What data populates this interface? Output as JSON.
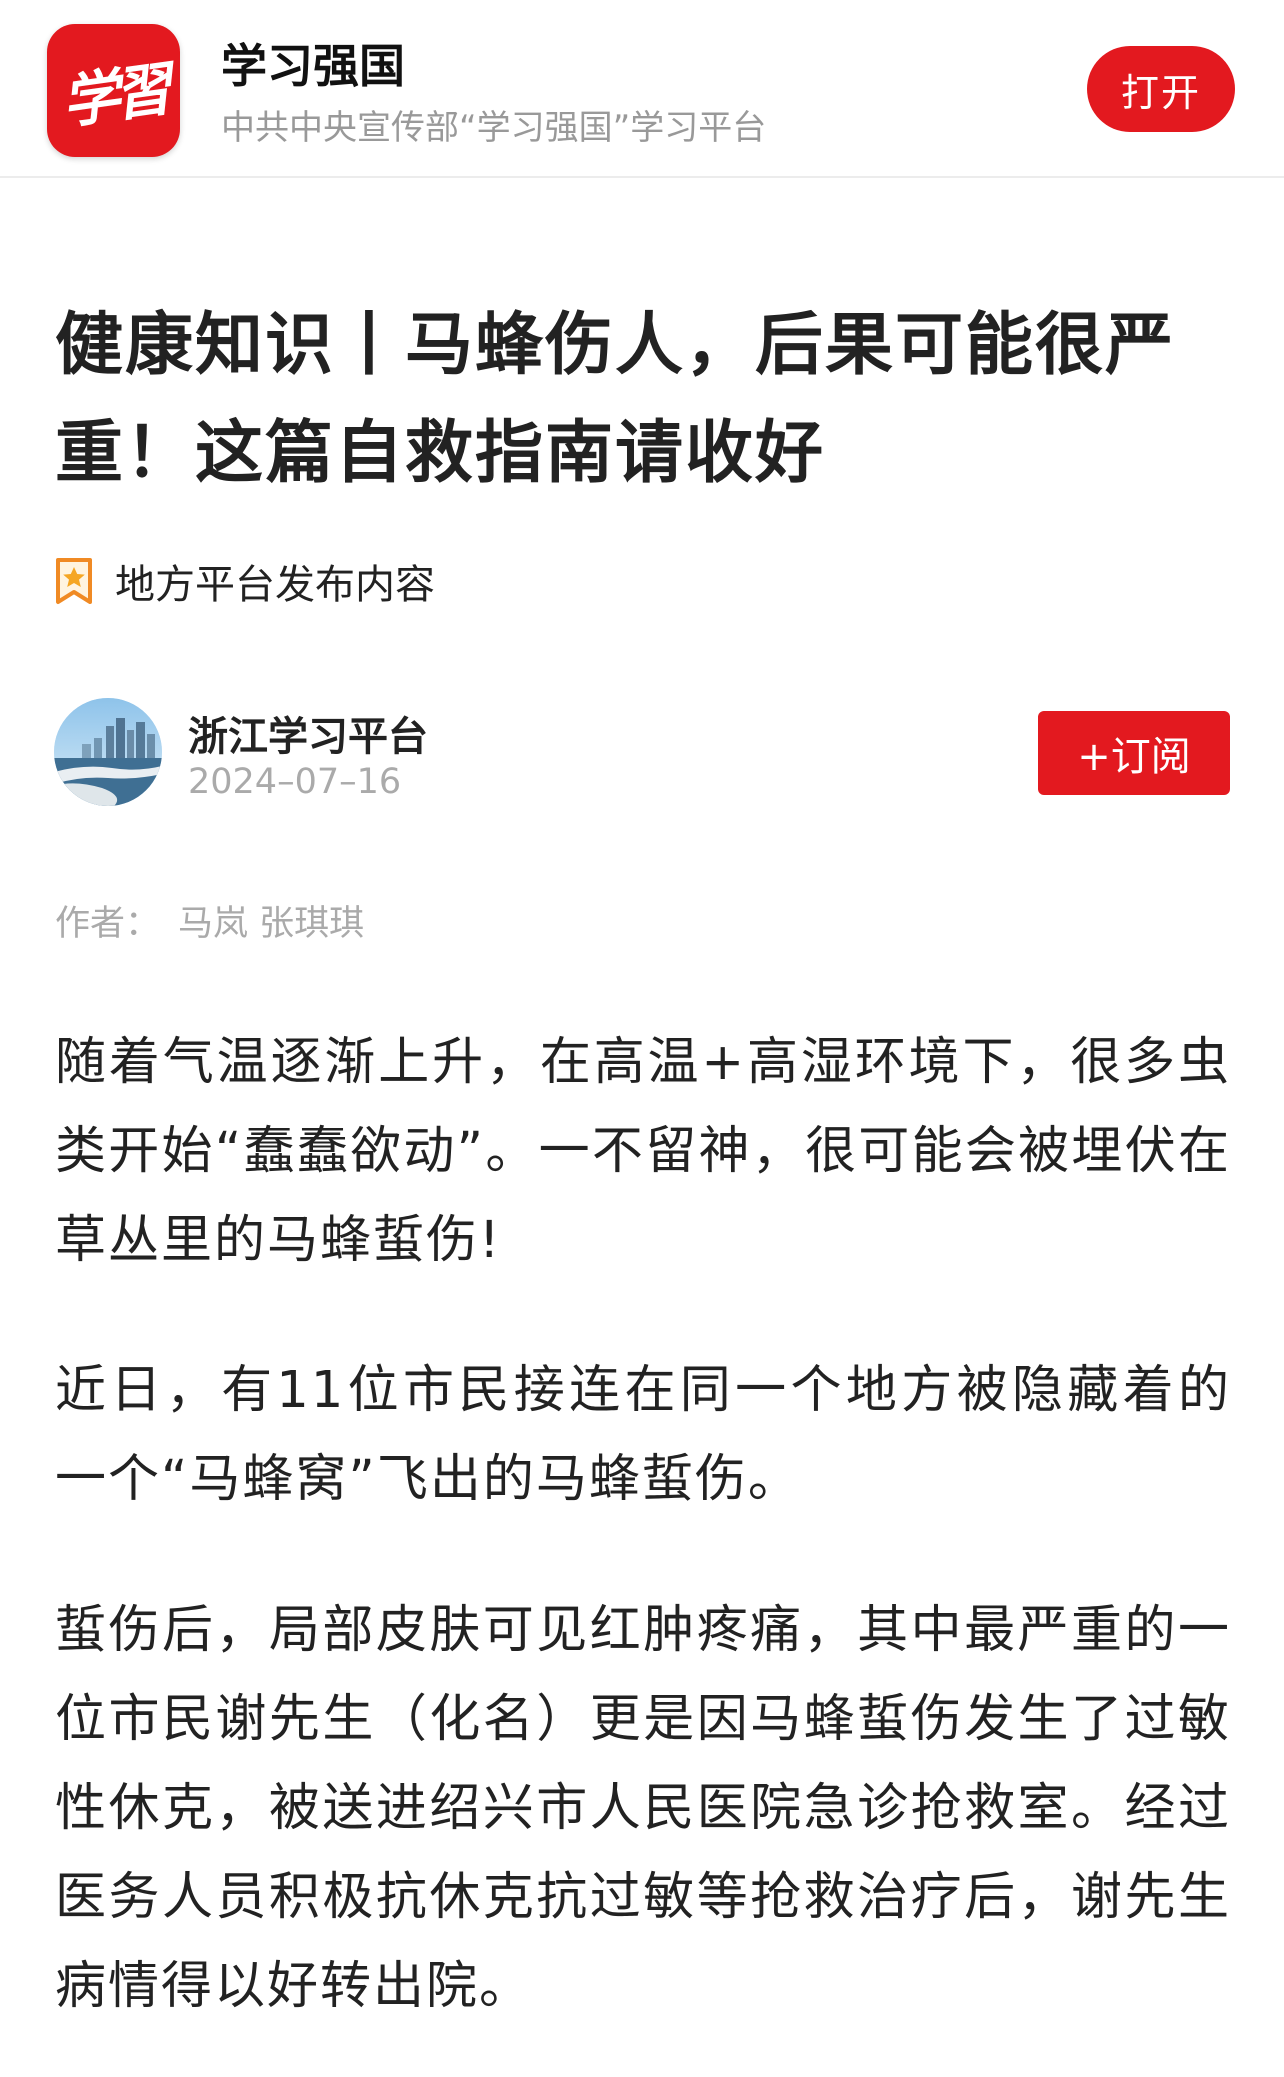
{
  "app_banner": {
    "icon_text": "学習",
    "name": "学习强国",
    "description": "中共中央宣传部“学习强国”学习平台",
    "open_label": "打开"
  },
  "article": {
    "title": "健康知识丨马蜂伤人，后果可能很严重！这篇自救指南请收好",
    "source_tag": "地方平台发布内容",
    "publisher": {
      "name": "浙江学习平台",
      "date": "2024–07–16",
      "subscribe_label": "+订阅"
    },
    "author_label": "作者：",
    "author_names": "马岚 张琪琪",
    "paragraphs": [
      "随着气温逐渐上升，在高温+高湿环境下，很多虫类开始“蠢蠢欲动”。一不留神，很可能会被埋伏在草丛里的马蜂蜇伤!",
      "近日，有11位市民接连在同一个地方被隐藏着的一个“马蜂窝”飞出的马蜂蜇伤。",
      "蜇伤后，局部皮肤可见红肿疼痛，其中最严重的一位市民谢先生（化名）更是因马蜂蜇伤发生了过敏性休克，被送进绍兴市人民医院急诊抢救室。经过医务人员积极抗休克抗过敏等抢救治疗后，谢先生病情得以好转出院。"
    ]
  },
  "colors": {
    "brand_red": "#e3191f",
    "text_primary": "#222222",
    "text_secondary": "#999999",
    "bookmark_orange": "#f5a623"
  },
  "icons": {
    "app_icon": "xuexi-logo-icon",
    "source_tag_icon": "bookmark-star-icon",
    "publisher_avatar": "city-skyline-avatar"
  }
}
